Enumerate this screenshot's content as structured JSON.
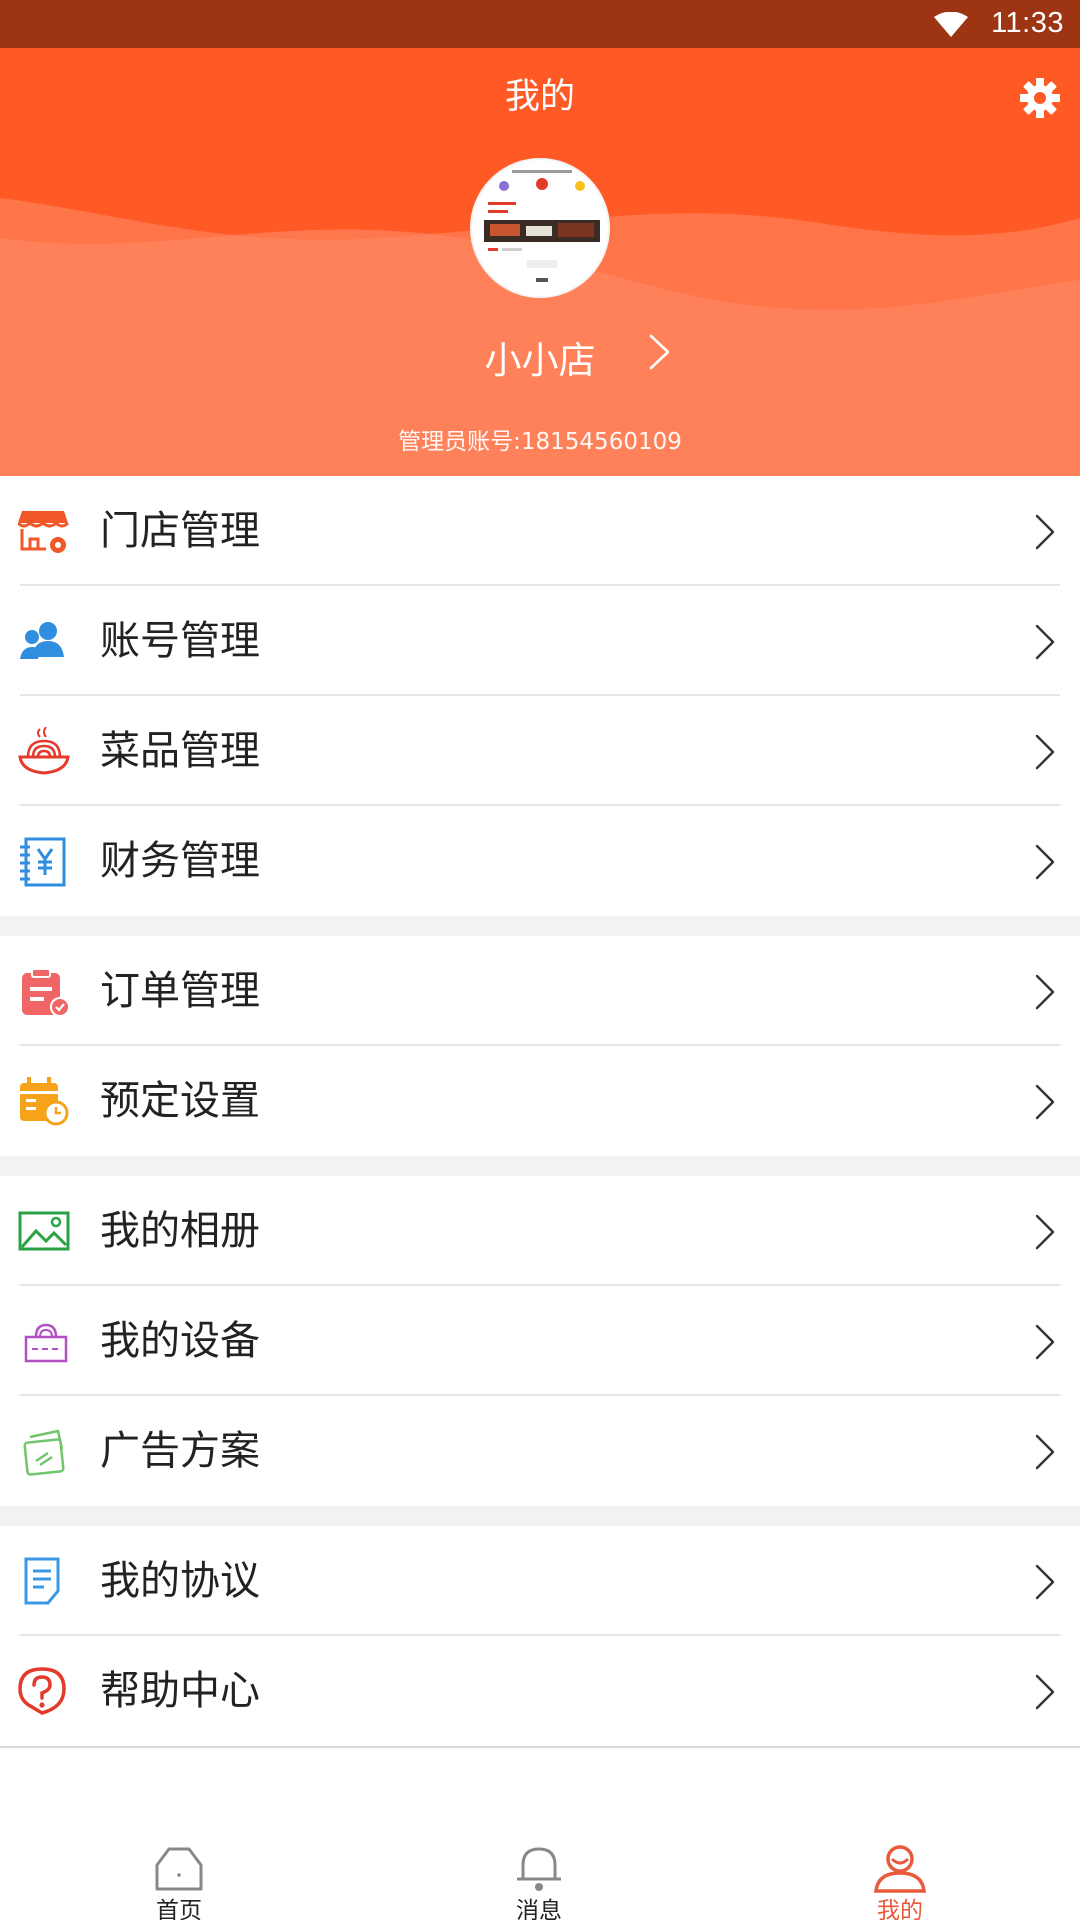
{
  "status_bar": {
    "time": "11:33"
  },
  "header": {
    "title": "我的",
    "store_name": "小小店",
    "account": "管理员账号:18154560109",
    "color": "#ff5a26"
  },
  "menu_groups": [
    [
      {
        "label": "门店管理",
        "icon": "store-settings-icon",
        "color": "#f0582a"
      },
      {
        "label": "账号管理",
        "icon": "users-icon",
        "color": "#2f8ee0"
      },
      {
        "label": "菜品管理",
        "icon": "noodle-bowl-icon",
        "color": "#e33a2b"
      },
      {
        "label": "财务管理",
        "icon": "finance-book-icon",
        "color": "#2f8ee0"
      }
    ],
    [
      {
        "label": "订单管理",
        "icon": "order-clipboard-icon",
        "color": "#f06666"
      },
      {
        "label": "预定设置",
        "icon": "calendar-clock-icon",
        "color": "#f6a31b"
      }
    ],
    [
      {
        "label": "我的相册",
        "icon": "photo-album-icon",
        "color": "#2ba344"
      },
      {
        "label": "我的设备",
        "icon": "device-icon",
        "color": "#b34fc4"
      },
      {
        "label": "广告方案",
        "icon": "ad-cards-icon",
        "color": "#72c56a"
      }
    ],
    [
      {
        "label": "我的协议",
        "icon": "agreement-document-icon",
        "color": "#3a98e6"
      },
      {
        "label": "帮助中心",
        "icon": "help-question-icon",
        "color": "#e33a2b"
      }
    ]
  ],
  "tabbar": {
    "tabs": [
      {
        "label": "首页",
        "icon": "home-icon"
      },
      {
        "label": "消息",
        "icon": "bell-icon"
      },
      {
        "label": "我的",
        "icon": "user-icon",
        "active": true
      }
    ],
    "active_color": "#e85a3c"
  }
}
